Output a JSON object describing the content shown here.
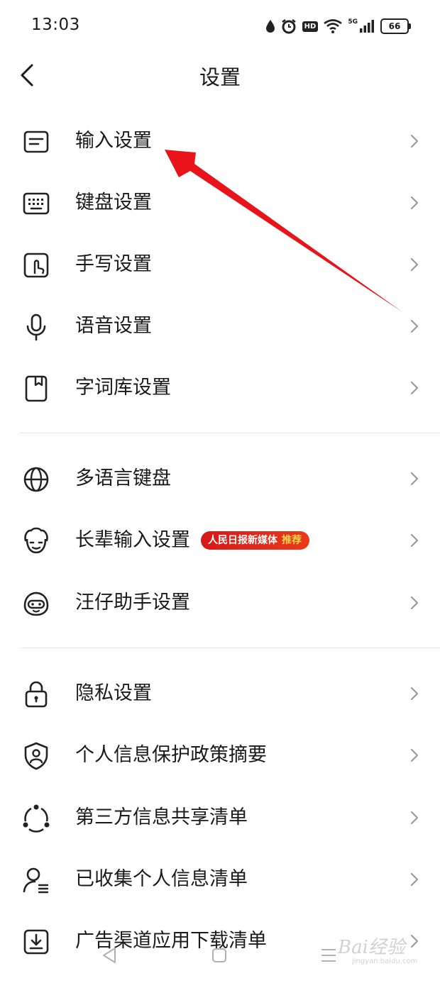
{
  "status_bar": {
    "time": "13:03",
    "battery": "66",
    "network": "5G",
    "hd": "HD"
  },
  "header": {
    "title": "设置"
  },
  "groups": [
    [
      {
        "label": "输入设置",
        "icon": "input-settings-icon"
      },
      {
        "label": "键盘设置",
        "icon": "keyboard-icon"
      },
      {
        "label": "手写设置",
        "icon": "handwriting-icon"
      },
      {
        "label": "语音设置",
        "icon": "microphone-icon"
      },
      {
        "label": "字词库设置",
        "icon": "dictionary-icon"
      }
    ],
    [
      {
        "label": "多语言键盘",
        "icon": "globe-icon"
      },
      {
        "label": "长辈输入设置",
        "icon": "elder-face-icon",
        "badge": {
          "text": "人民日报新媒体",
          "highlight": "推荐"
        }
      },
      {
        "label": "汪仔助手设置",
        "icon": "mascot-icon"
      }
    ],
    [
      {
        "label": "隐私设置",
        "icon": "lock-icon"
      },
      {
        "label": "个人信息保护政策摘要",
        "icon": "shield-person-icon"
      },
      {
        "label": "第三方信息共享清单",
        "icon": "share-icon"
      },
      {
        "label": "已收集个人信息清单",
        "icon": "person-list-icon"
      },
      {
        "label": "广告渠道应用下载清单",
        "icon": "download-icon"
      }
    ]
  ],
  "watermark": {
    "main": "Bai经验",
    "sub": "jingyan.baidu.com"
  },
  "colors": {
    "annotation_arrow": "#e8141a",
    "badge": "#d71818",
    "badge_highlight": "#ffd64a"
  }
}
